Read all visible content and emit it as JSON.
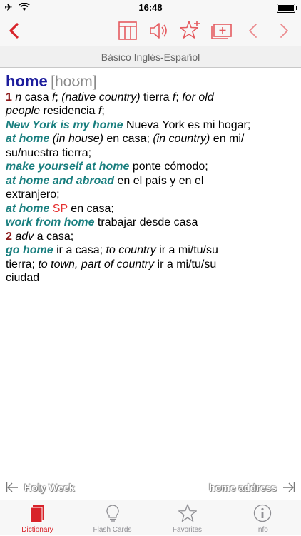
{
  "status_bar": {
    "time": "16:48"
  },
  "header": {
    "title": "Básico Inglés-Español"
  },
  "entry": {
    "headword": "home",
    "pronunciation": "[hoʊm]",
    "lines": [
      [
        {
          "t": "1",
          "c": "num"
        },
        {
          "t": " "
        },
        {
          "t": "n",
          "c": "lab"
        },
        {
          "t": " casa "
        },
        {
          "t": "f",
          "c": "lab"
        },
        {
          "t": "; "
        },
        {
          "t": "(native country)",
          "c": "lab"
        },
        {
          "t": " tierra "
        },
        {
          "t": "f",
          "c": "lab"
        },
        {
          "t": "; "
        },
        {
          "t": "for old",
          "c": "lab"
        }
      ],
      [
        {
          "t": "people",
          "c": "lab"
        },
        {
          "t": " residencia "
        },
        {
          "t": "f",
          "c": "lab"
        },
        {
          "t": ";"
        }
      ],
      [
        {
          "t": "New York is my home",
          "c": "ph"
        },
        {
          "t": " Nueva York es mi hogar;"
        }
      ],
      [
        {
          "t": "at home",
          "c": "ph"
        },
        {
          "t": " "
        },
        {
          "t": "(in house)",
          "c": "lab"
        },
        {
          "t": " en casa; "
        },
        {
          "t": "(in country)",
          "c": "lab"
        },
        {
          "t": " en mi/"
        }
      ],
      [
        {
          "t": "su/nuestra tierra;"
        }
      ],
      [
        {
          "t": "make yourself at home",
          "c": "ph"
        },
        {
          "t": " ponte cómodo;"
        }
      ],
      [
        {
          "t": "at home and abroad",
          "c": "ph"
        },
        {
          "t": " en el país y en el"
        }
      ],
      [
        {
          "t": "extranjero;"
        }
      ],
      [
        {
          "t": "at home",
          "c": "ph"
        },
        {
          "t": " "
        },
        {
          "t": "SP",
          "c": "sp"
        },
        {
          "t": " en casa;"
        }
      ],
      [
        {
          "t": "work from home",
          "c": "ph"
        },
        {
          "t": " trabajar desde casa"
        }
      ],
      [
        {
          "t": "2",
          "c": "num"
        },
        {
          "t": " "
        },
        {
          "t": "adv",
          "c": "lab"
        },
        {
          "t": " a casa;"
        }
      ],
      [
        {
          "t": "go home",
          "c": "ph"
        },
        {
          "t": " ir a casa; "
        },
        {
          "t": "to country",
          "c": "lab"
        },
        {
          "t": " ir a mi/tu/su"
        }
      ],
      [
        {
          "t": "tierra; "
        },
        {
          "t": "to town, part of country",
          "c": "lab"
        },
        {
          "t": " ir a mi/tu/su"
        }
      ],
      [
        {
          "t": "ciudad"
        }
      ]
    ]
  },
  "nav": {
    "prev": "Holy Week",
    "next": "home address"
  },
  "tabs": [
    {
      "label": "Dictionary",
      "icon": "book-icon",
      "active": true
    },
    {
      "label": "Flash Cards",
      "icon": "lightbulb-icon",
      "active": false
    },
    {
      "label": "Favorites",
      "icon": "star-icon",
      "active": false
    },
    {
      "label": "Info",
      "icon": "info-icon",
      "active": false
    }
  ],
  "colors": {
    "accent": "#d8232a",
    "headword": "#1c1c9c",
    "phrase": "#1a7f7f",
    "sense_number": "#8b1a1a",
    "region_label": "#e53030"
  }
}
